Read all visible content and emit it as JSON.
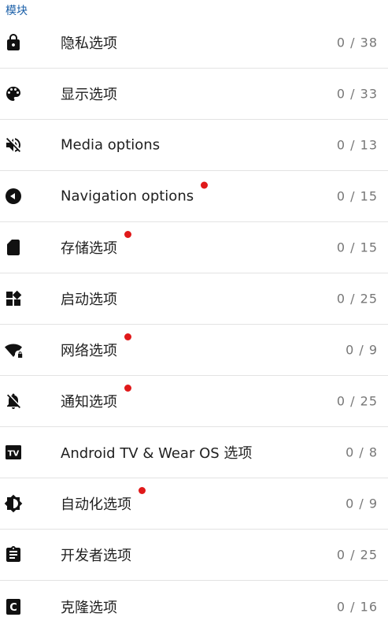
{
  "section": {
    "title": "模块"
  },
  "rows": [
    {
      "label": "隐私选项",
      "count": "0 / 38",
      "icon": "lock-icon",
      "dot": false
    },
    {
      "label": "显示选项",
      "count": "0 / 33",
      "icon": "palette-icon",
      "dot": false
    },
    {
      "label": "Media options",
      "count": "0 / 13",
      "icon": "volume-off-icon",
      "dot": false
    },
    {
      "label": "Navigation options",
      "count": "0 / 15",
      "icon": "back-arrow-circle-icon",
      "dot": true
    },
    {
      "label": "存储选项",
      "count": "0 / 15",
      "icon": "sd-card-icon",
      "dot": true
    },
    {
      "label": "启动选项",
      "count": "0 / 25",
      "icon": "widgets-icon",
      "dot": false
    },
    {
      "label": "网络选项",
      "count": "0 / 9",
      "icon": "wifi-lock-icon",
      "dot": true
    },
    {
      "label": "通知选项",
      "count": "0 / 25",
      "icon": "notifications-off-icon",
      "dot": true
    },
    {
      "label": "Android TV & Wear OS 选项",
      "count": "0 / 8",
      "icon": "tv-icon",
      "dot": false
    },
    {
      "label": "自动化选项",
      "count": "0 / 9",
      "icon": "brightness-auto-icon",
      "dot": true
    },
    {
      "label": "开发者选项",
      "count": "0 / 25",
      "icon": "clipboard-icon",
      "dot": false
    },
    {
      "label": "克隆选项",
      "count": "0 / 16",
      "icon": "clone-c-icon",
      "dot": false
    }
  ],
  "colors": {
    "accent": "#1a5fa8",
    "dot": "#e0191a",
    "count": "#777777"
  }
}
